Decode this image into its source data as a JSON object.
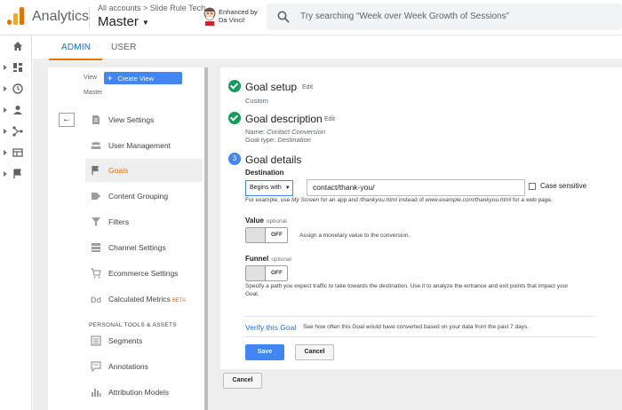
{
  "app": {
    "title": "Analytics",
    "breadcrumb": "All accounts > Slide Rule Tech",
    "account": "Master",
    "enhanced_line1": "Enhanced by",
    "enhanced_line2": "Da Vinci!",
    "search_placeholder": "Try searching “Week over Week Growth of Sessions”"
  },
  "rail": {
    "items": [
      "home-icon",
      "dashboard-icon",
      "clock-icon",
      "person-icon",
      "acquisition-icon",
      "behavior-icon",
      "flag-icon"
    ]
  },
  "tabs": {
    "admin": "ADMIN",
    "user": "USER"
  },
  "nav": {
    "view_label": "View",
    "create_view": "Create View",
    "master": "Master",
    "items": [
      {
        "label": "View Settings",
        "icon": "document-icon"
      },
      {
        "label": "User Management",
        "icon": "users-icon"
      },
      {
        "label": "Goals",
        "icon": "flag-icon"
      },
      {
        "label": "Content Grouping",
        "icon": "content-grouping-icon"
      },
      {
        "label": "Filters",
        "icon": "filter-icon"
      },
      {
        "label": "Channel Settings",
        "icon": "channel-icon"
      },
      {
        "label": "Ecommerce Settings",
        "icon": "cart-icon"
      },
      {
        "label": "Calculated Metrics",
        "icon": "dd-icon"
      }
    ],
    "beta": "BETA",
    "section_personal": "PERSONAL TOOLS & ASSETS",
    "personal_items": [
      {
        "label": "Segments",
        "icon": "segments-icon"
      },
      {
        "label": "Annotations",
        "icon": "annotation-icon"
      },
      {
        "label": "Attribution Models",
        "icon": "bar-chart-icon"
      }
    ]
  },
  "goal": {
    "setup_title": "Goal setup",
    "setup_edit": "Edit",
    "setup_value": "Custom",
    "desc_title": "Goal description",
    "desc_edit": "Edit",
    "name_prefix": "Name:",
    "name_value": "Contact Conversion",
    "type_prefix": "Goal type:",
    "type_value": "Destination",
    "details_step": "3",
    "details_title": "Goal details",
    "destination_label": "Destination",
    "match_type": "Begins with",
    "destination_value": "contact/thank-you/",
    "case_sensitive": "Case sensitive",
    "hint_1": "For example, use ",
    "hint_2": "My Screen",
    "hint_3": " for an app and ",
    "hint_4": "/thankyou.html",
    "hint_5": " instead of ",
    "hint_6": "www.example.com/thankyou.html",
    "hint_7": " for a web page.",
    "value_label": "Value",
    "optional": "optional",
    "value_toggle": "OFF",
    "value_desc": "Assign a monetary value to the conversion.",
    "funnel_label": "Funnel",
    "funnel_toggle": "OFF",
    "funnel_desc_1": "Specify a path you expect traffic to take towards the destination. Use it to analyze the entrance and exit points that impact your",
    "funnel_desc_2": "Goal.",
    "verify_link": "Verify this Goal",
    "verify_desc": "See how often this Goal would have converted based on your data from the past 7 days.",
    "save": "Save",
    "cancel": "Cancel",
    "outer_cancel": "Cancel"
  }
}
